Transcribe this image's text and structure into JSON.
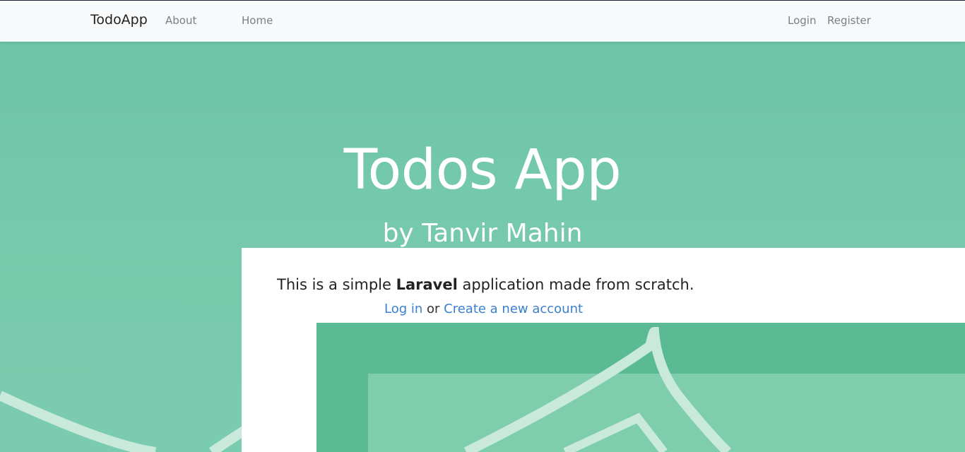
{
  "navbar": {
    "brand": "TodoApp",
    "left_links": [
      "About",
      "Home"
    ],
    "right_links": [
      "Login",
      "Register"
    ]
  },
  "hero": {
    "title": "Todos App",
    "subtitle": "by Tanvir Mahin"
  },
  "card": {
    "text_before": "This is a simple ",
    "text_bold": "Laravel",
    "text_after": " application made from scratch.",
    "login_link": "Log in",
    "or_text": " or ",
    "register_link": "Create a new account"
  },
  "colors": {
    "hero_bg": "#73c8a9",
    "link": "#3a7fd0",
    "illus_dark": "#5aba94",
    "illus_light": "#7ecdad"
  }
}
